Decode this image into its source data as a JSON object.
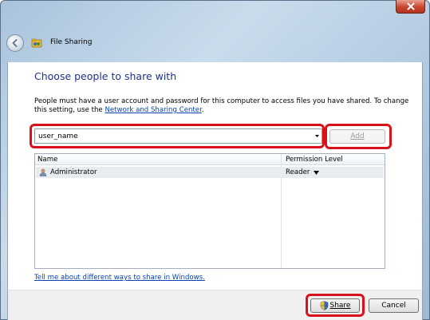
{
  "window": {
    "title": "File Sharing",
    "close_icon": "close-icon",
    "back_icon": "back-arrow-icon",
    "title_icon": "file-sharing-icon"
  },
  "main": {
    "heading": "Choose people to share with",
    "description": "People must have a user account and password for this computer to access files you have shared.  To change this setting, use the",
    "description_link": "Network and Sharing Center",
    "description_end": "."
  },
  "combo": {
    "value": "user_name",
    "dropdown_icon": "chevron-down-icon"
  },
  "add_button": {
    "label": "Add",
    "enabled": false
  },
  "list": {
    "columns": [
      "Name",
      "Permission Level"
    ],
    "rows": [
      {
        "name": "Administrator",
        "permission": "Reader",
        "icon": "user-icon"
      }
    ]
  },
  "help_link": "Tell me about different ways to share in Windows.",
  "footer": {
    "share_label": "Share",
    "share_icon": "uac-shield-icon",
    "cancel_label": "Cancel"
  },
  "colors": {
    "highlight": "#d9111b",
    "heading": "#1e3287",
    "link": "#0b43b0"
  }
}
